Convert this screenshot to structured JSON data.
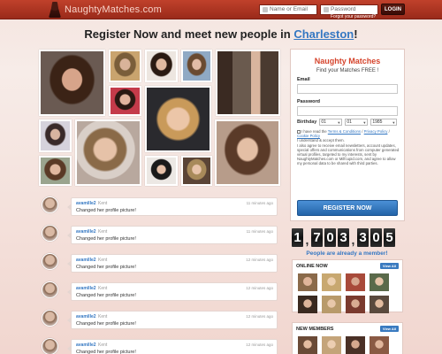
{
  "header": {
    "logo_text": "NaughtyMatches.com",
    "email_placeholder": "Name or Email",
    "password_placeholder": "Password",
    "login_label": "LOGIN",
    "forgot_label": "Forgot your password?"
  },
  "headline": {
    "prefix": "Register Now and meet new people in ",
    "city": "Charleston",
    "suffix": "!"
  },
  "registration": {
    "title": "Naughty Matches",
    "subtitle": "Find your Matches FREE !",
    "email_label": "Email",
    "password_label": "Password",
    "birthday_label": "Birthday",
    "birth_month": "01",
    "birth_day": "01",
    "birth_year": "1985",
    "terms_prefix": "I have read the ",
    "terms_link": "Terms & Conditions",
    "privacy_link": "Privacy Policy",
    "cookie_link": "Cookie Policy",
    "consent_1": "I understand & accept them.",
    "consent_2": "I also agree to receive email newsletters, account updates, special offers and communications from computer generated virtual profiles, targeted to my interests, sent by NaughtyMatches.com or Milfcupid.com, and agree to allow my personal data to be shared with third parties.",
    "button_label": "REGISTER NOW"
  },
  "counter": {
    "digits": [
      "1",
      ",",
      "7",
      "0",
      "3",
      ",",
      "3",
      "0",
      "5"
    ],
    "label": "People are already a member!"
  },
  "online_now": {
    "title": "ONLINE NOW",
    "view_all": "View All"
  },
  "new_members": {
    "title": "NEW MEMBERS",
    "view_all": "View All"
  },
  "feed": [
    {
      "user": "avamille2",
      "city": "Kent",
      "text": "Changed her profile picture!",
      "time": "11 minutes ago"
    },
    {
      "user": "avamille2",
      "city": "Kent",
      "text": "Changed her profile picture!",
      "time": "11 minutes ago"
    },
    {
      "user": "avamille2",
      "city": "Kent",
      "text": "Changed her profile picture!",
      "time": "12 minutes ago"
    },
    {
      "user": "avamille2",
      "city": "Kent",
      "text": "Changed her profile picture!",
      "time": "12 minutes ago"
    },
    {
      "user": "avamille2",
      "city": "Kent",
      "text": "Changed her profile picture!",
      "time": "12 minutes ago"
    },
    {
      "user": "avamille2",
      "city": "Kent",
      "text": "Changed her profile picture!",
      "time": "12 minutes ago"
    }
  ],
  "colors": {
    "brand_red": "#c0412b",
    "link_blue": "#3477c2",
    "button_blue": "#2f73b8"
  }
}
